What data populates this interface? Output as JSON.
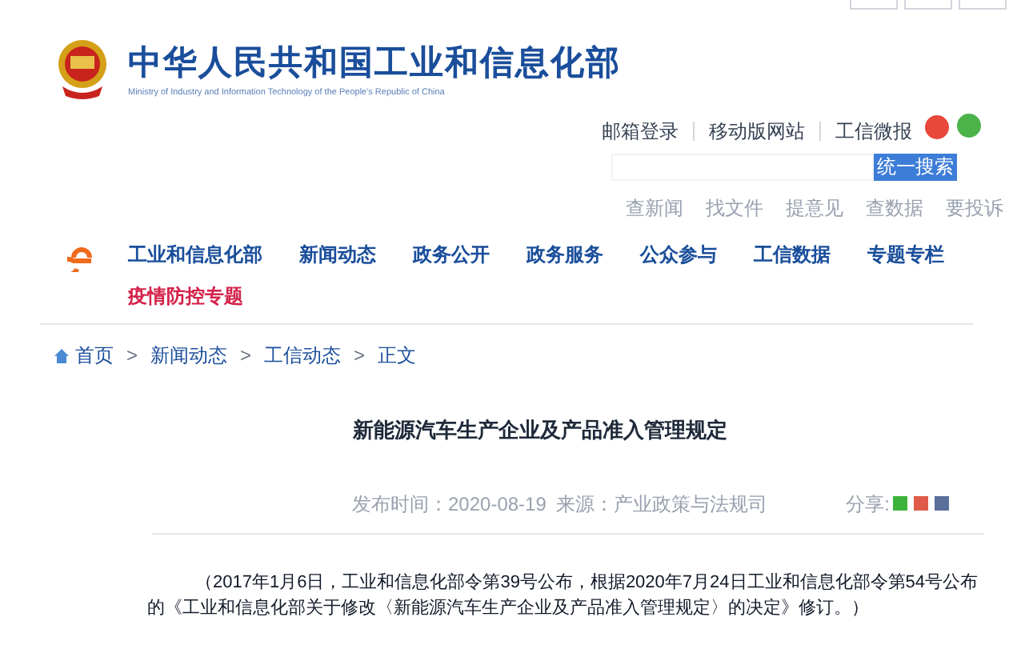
{
  "header": {
    "title": "中华人民共和国工业和信息化部",
    "subtitle": "Ministry of Industry and Information Technology of the People's Republic of China"
  },
  "top_links": [
    "邮箱登录",
    "移动版网站",
    "工信微报"
  ],
  "search": {
    "button": "统一搜索"
  },
  "quick_links": [
    "查新闻",
    "找文件",
    "提意见",
    "查数据",
    "要投诉"
  ],
  "nav": [
    {
      "label": "工业和信息化部",
      "kind": "normal"
    },
    {
      "label": "新闻动态",
      "kind": "normal"
    },
    {
      "label": "政务公开",
      "kind": "normal"
    },
    {
      "label": "政务服务",
      "kind": "normal"
    },
    {
      "label": "公众参与",
      "kind": "normal"
    },
    {
      "label": "工信数据",
      "kind": "normal"
    },
    {
      "label": "专题专栏",
      "kind": "normal"
    },
    {
      "label": "疫情防控专题",
      "kind": "highlight"
    }
  ],
  "breadcrumb": [
    "首页",
    "新闻动态",
    "工信动态",
    "正文"
  ],
  "breadcrumb_separator": ">",
  "article": {
    "title": "新能源汽车生产企业及产品准入管理规定",
    "published": "发布时间：2020-08-19",
    "source": "来源：产业政策与法规司",
    "share_label": "分享:",
    "body": "（2017年1月6日，工业和信息化部令第39号公布，根据2020年7月24日工业和信息化部令第54号公布的《工业和信息化部关于修改〈新能源汽车生产企业及产品准入管理规定〉的决定》修订。）"
  }
}
